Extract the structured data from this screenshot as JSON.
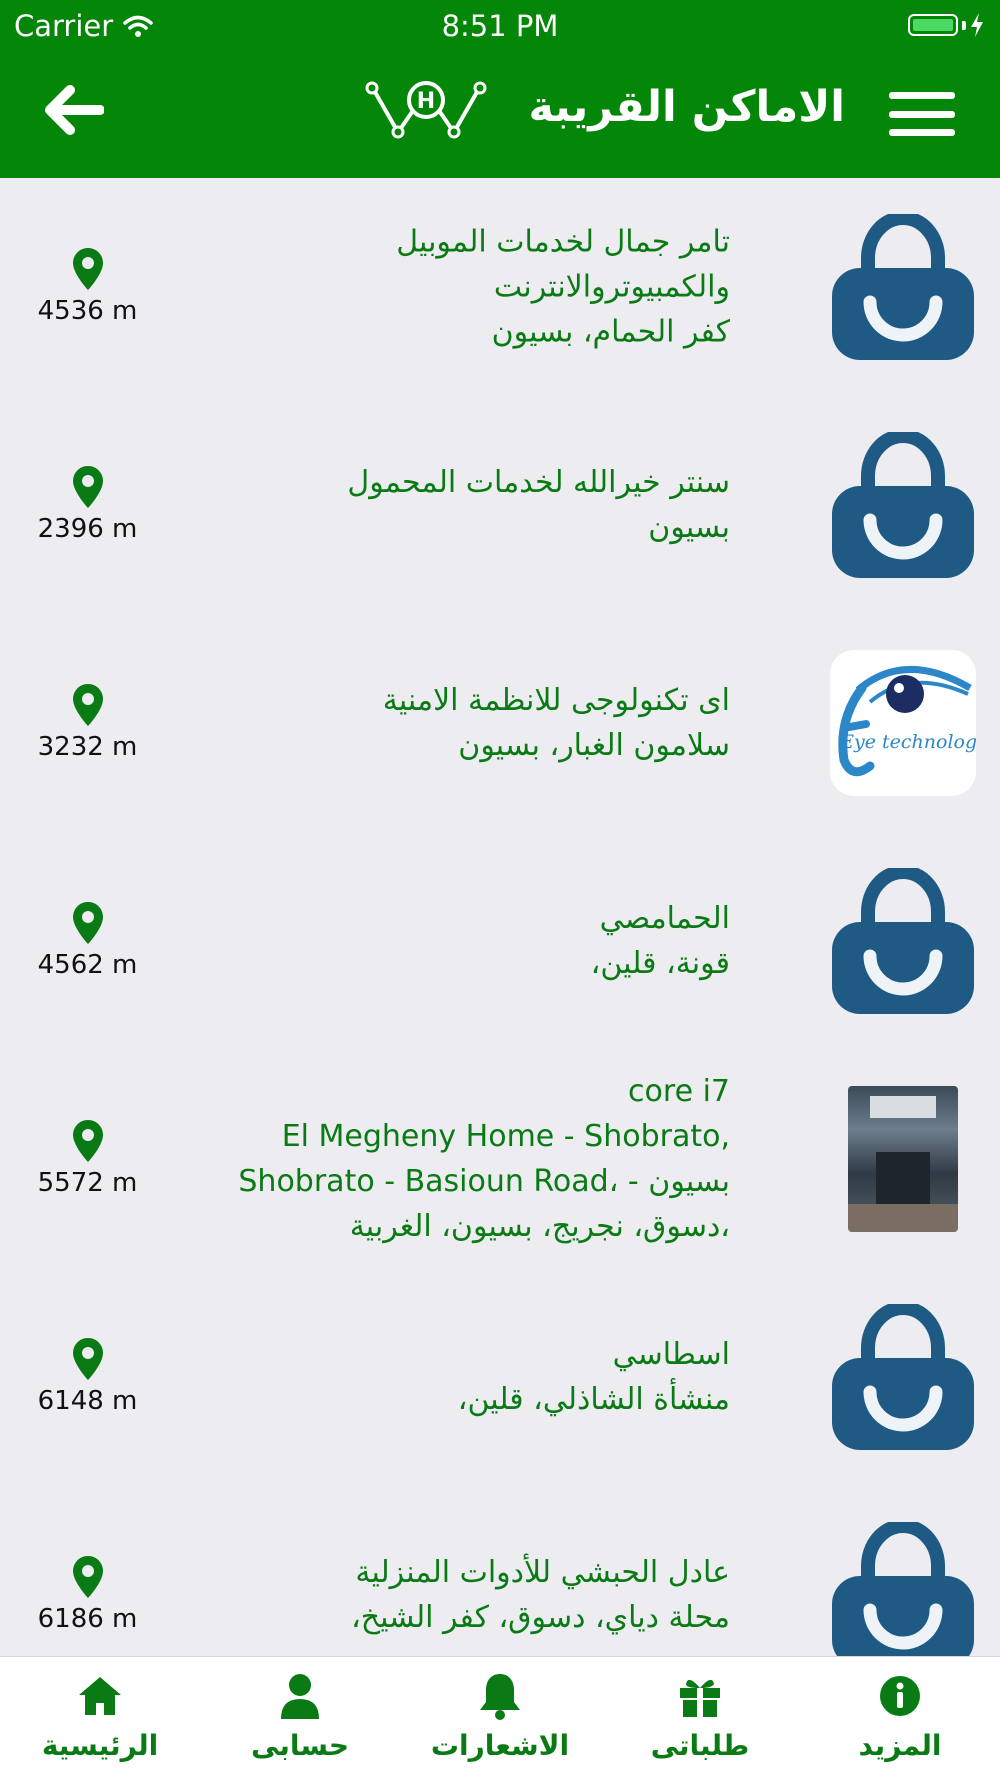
{
  "status": {
    "carrier": "Carrier",
    "time": "8:51 PM"
  },
  "header": {
    "title": "الاماكن القريبة",
    "logo_letter": "H"
  },
  "places": [
    {
      "name": "تامر جمال لخدمات الموبيل والكمبيوتروالانترنت",
      "lines": [
        "تامر جمال لخدمات الموبيل",
        "والكمبيوتروالانترنت",
        "كفر الحمام، بسيون"
      ],
      "distance": "4536 m",
      "image": "bag-icon"
    },
    {
      "lines": [
        "سنتر خيرالله لخدمات المحمول",
        "بسيون"
      ],
      "distance": "2396 m",
      "image": "bag-icon"
    },
    {
      "lines": [
        "اى تكنولوجى للانظمة الامنية",
        "سلامون الغبار، بسيون"
      ],
      "distance": "3232 m",
      "image": "eye-technology-logo",
      "logo_text": "Eye technology"
    },
    {
      "lines": [
        "الحمامصي",
        "قونة، قلين،"
      ],
      "distance": "4562 m",
      "image": "bag-icon"
    },
    {
      "lines": [
        "core i7",
        "El Megheny Home - Shobrato,",
        "Shobrato - Basioun Road، - بسيون",
        "،دسوق، نجريج، بسيون، الغربية"
      ],
      "distance": "5572 m",
      "image": "shop-photo"
    },
    {
      "lines": [
        "اسطاسي",
        "منشأة الشاذلي، قلين،"
      ],
      "distance": "6148 m",
      "image": "bag-icon"
    },
    {
      "lines": [
        "عادل الحبشي للأدوات المنزلية",
        "محلة دياي، دسوق، كفر الشيخ،"
      ],
      "distance": "6186 m",
      "image": "bag-icon"
    }
  ],
  "tabs": [
    {
      "label": "الرئيسية",
      "icon": "home-icon"
    },
    {
      "label": "حسابى",
      "icon": "user-icon"
    },
    {
      "label": "الاشعارات",
      "icon": "bell-icon"
    },
    {
      "label": "طلباتى",
      "icon": "gift-icon"
    },
    {
      "label": "المزيد",
      "icon": "info-icon"
    }
  ],
  "colors": {
    "brand_green": "#048708",
    "text_green": "#0a7a14",
    "bag_blue": "#1f5a84",
    "background": "#ececf1"
  }
}
